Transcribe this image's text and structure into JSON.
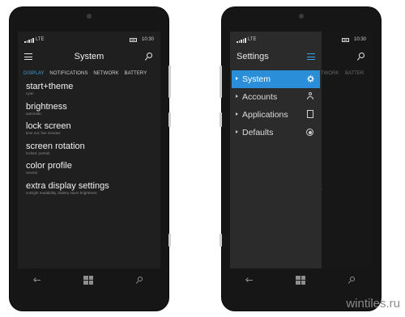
{
  "status_bar": {
    "network": "LTE",
    "time": "10:30"
  },
  "left_phone": {
    "title": "System",
    "tabs": [
      {
        "label": "DISPLAY",
        "active": true
      },
      {
        "label": "NOTIFICATIONS",
        "active": false
      },
      {
        "label": "NETWORK",
        "active": false
      },
      {
        "label": "BATTERY",
        "active": false
      }
    ],
    "settings": [
      {
        "title": "start+theme",
        "subtitle": "cyan"
      },
      {
        "title": "brightness",
        "subtitle": "automatic"
      },
      {
        "title": "lock screen",
        "subtitle": "time out: five minutes"
      },
      {
        "title": "screen rotation",
        "subtitle": "locked: portrait"
      },
      {
        "title": "color profile",
        "subtitle": "neutral"
      },
      {
        "title": "extra display settings",
        "subtitle": "sunlight readability, battery saver brightness"
      }
    ]
  },
  "right_phone": {
    "pane_title": "Settings",
    "background_tabs": [
      "TWORK",
      "BATTER"
    ],
    "background_text": "e",
    "menu": [
      {
        "label": "System",
        "icon": "gear-icon",
        "selected": true
      },
      {
        "label": "Accounts",
        "icon": "person-icon",
        "selected": false
      },
      {
        "label": "Applications",
        "icon": "app-icon",
        "selected": false
      },
      {
        "label": "Defaults",
        "icon": "circle-icon",
        "selected": false
      }
    ]
  },
  "watermark": "wintiles.ru",
  "colors": {
    "accent": "#3aa3e3",
    "selection": "#2a8fd8",
    "screen_bg": "#1f1f1f",
    "pane_bg": "#2b2b2b"
  }
}
